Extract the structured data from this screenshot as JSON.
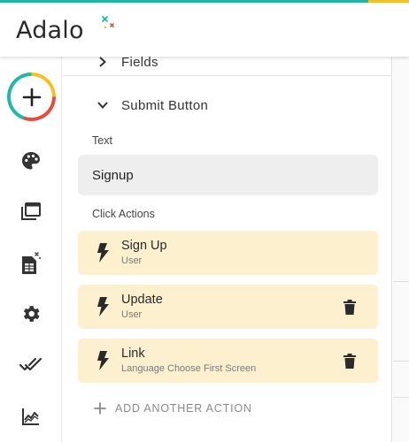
{
  "brand": {
    "logo_text": "Adalo",
    "accent_teal": "#1fb6a6",
    "accent_yellow": "#f6c023",
    "accent_red": "#e64b3c",
    "card_bg": "#fdf0cf"
  },
  "sidebar": {
    "items": [
      {
        "name": "add-component",
        "icon": "plus-icon"
      },
      {
        "name": "branding",
        "icon": "palette-icon"
      },
      {
        "name": "screens",
        "icon": "screens-icon"
      },
      {
        "name": "database",
        "icon": "database-icon"
      },
      {
        "name": "settings",
        "icon": "gear-icon"
      },
      {
        "name": "publish",
        "icon": "double-check-icon"
      },
      {
        "name": "analytics",
        "icon": "analytics-icon"
      }
    ]
  },
  "panel": {
    "fields_section": {
      "label": "Fields",
      "expanded": false
    },
    "submit_section": {
      "label": "Submit Button",
      "expanded": true
    },
    "text_label": "Text",
    "text_value": "Signup",
    "click_actions_label": "Click Actions",
    "actions": [
      {
        "title": "Sign Up",
        "subtitle": "User",
        "deletable": false
      },
      {
        "title": "Update",
        "subtitle": "User",
        "deletable": true
      },
      {
        "title": "Link",
        "subtitle": "Language Choose First Screen",
        "deletable": true
      }
    ],
    "add_action_label": "ADD ANOTHER ACTION"
  }
}
